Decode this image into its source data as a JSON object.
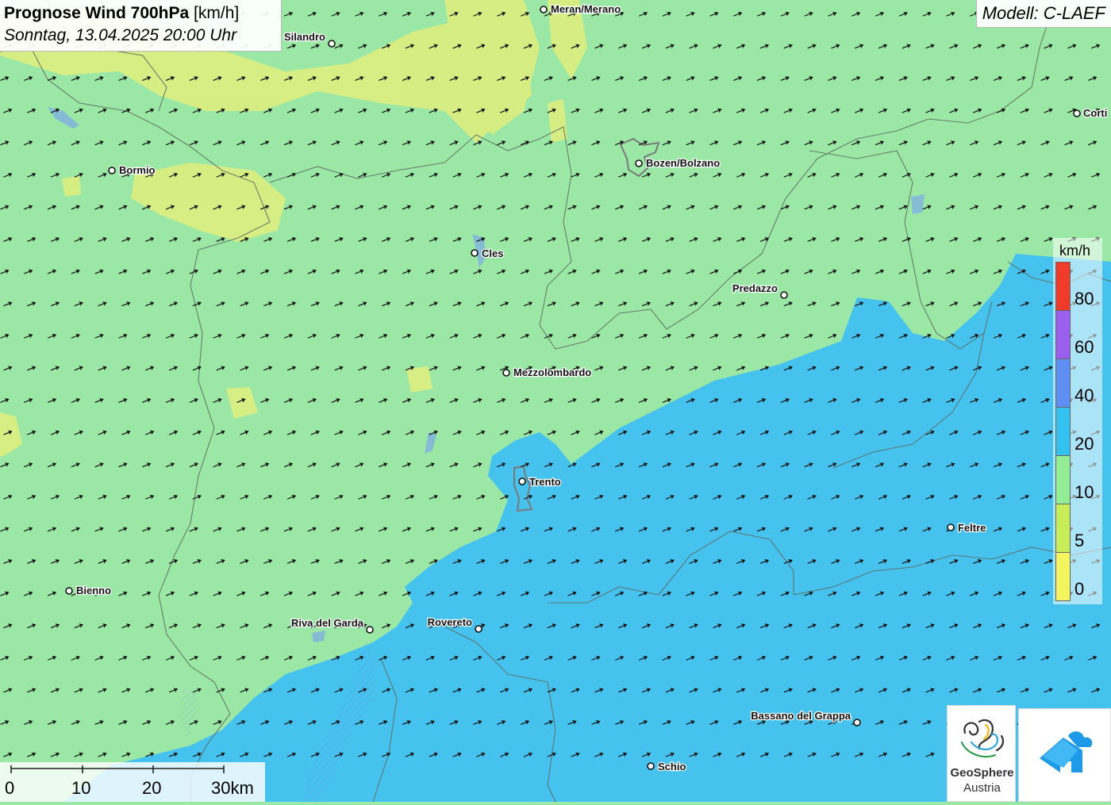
{
  "header": {
    "title_bold": "Prognose Wind 700hPa",
    "title_unit": "[km/h]",
    "subtitle": "Sonntag, 13.04.2025 20:00 Uhr"
  },
  "model": {
    "label": "Modell: C-LAEF"
  },
  "legend": {
    "unit": "km/h",
    "items": [
      {
        "label": "80",
        "color": "#f03a2a"
      },
      {
        "label": "60",
        "color": "#9b5ff0"
      },
      {
        "label": "40",
        "color": "#5e8ff2"
      },
      {
        "label": "20",
        "color": "#33c2ef"
      },
      {
        "label": "10",
        "color": "#92ee96"
      },
      {
        "label": "5",
        "color": "#c7ee58"
      },
      {
        "label": "0",
        "color": "#f3f45e"
      }
    ]
  },
  "scale_bar": {
    "labels": [
      "0",
      "10",
      "20",
      "30km"
    ]
  },
  "cities": [
    {
      "name": "Meran/Merano"
    },
    {
      "name": "Silandro"
    },
    {
      "name": "Bormio"
    },
    {
      "name": "Bozen/Bolzano"
    },
    {
      "name": "Cles"
    },
    {
      "name": "Predazzo"
    },
    {
      "name": "Mezzolombardo"
    },
    {
      "name": "Trento"
    },
    {
      "name": "Feltre"
    },
    {
      "name": "Bienno"
    },
    {
      "name": "Riva del Garda"
    },
    {
      "name": "Rovereto"
    },
    {
      "name": "Bassano del Grappa"
    },
    {
      "name": "Schio"
    },
    {
      "name": "Corti"
    }
  ],
  "wind": {
    "direction": "from south-west",
    "arrow_color": "#111111"
  },
  "logos": {
    "geosphere_name": "GeoSphere",
    "geosphere_sub": "Austria",
    "app_icon": "cloud-house-icon"
  },
  "colors": {
    "green_zone": "#9be8a6",
    "blue_zone": "#45c3ee",
    "yellow_zone": "#d9ee82"
  }
}
